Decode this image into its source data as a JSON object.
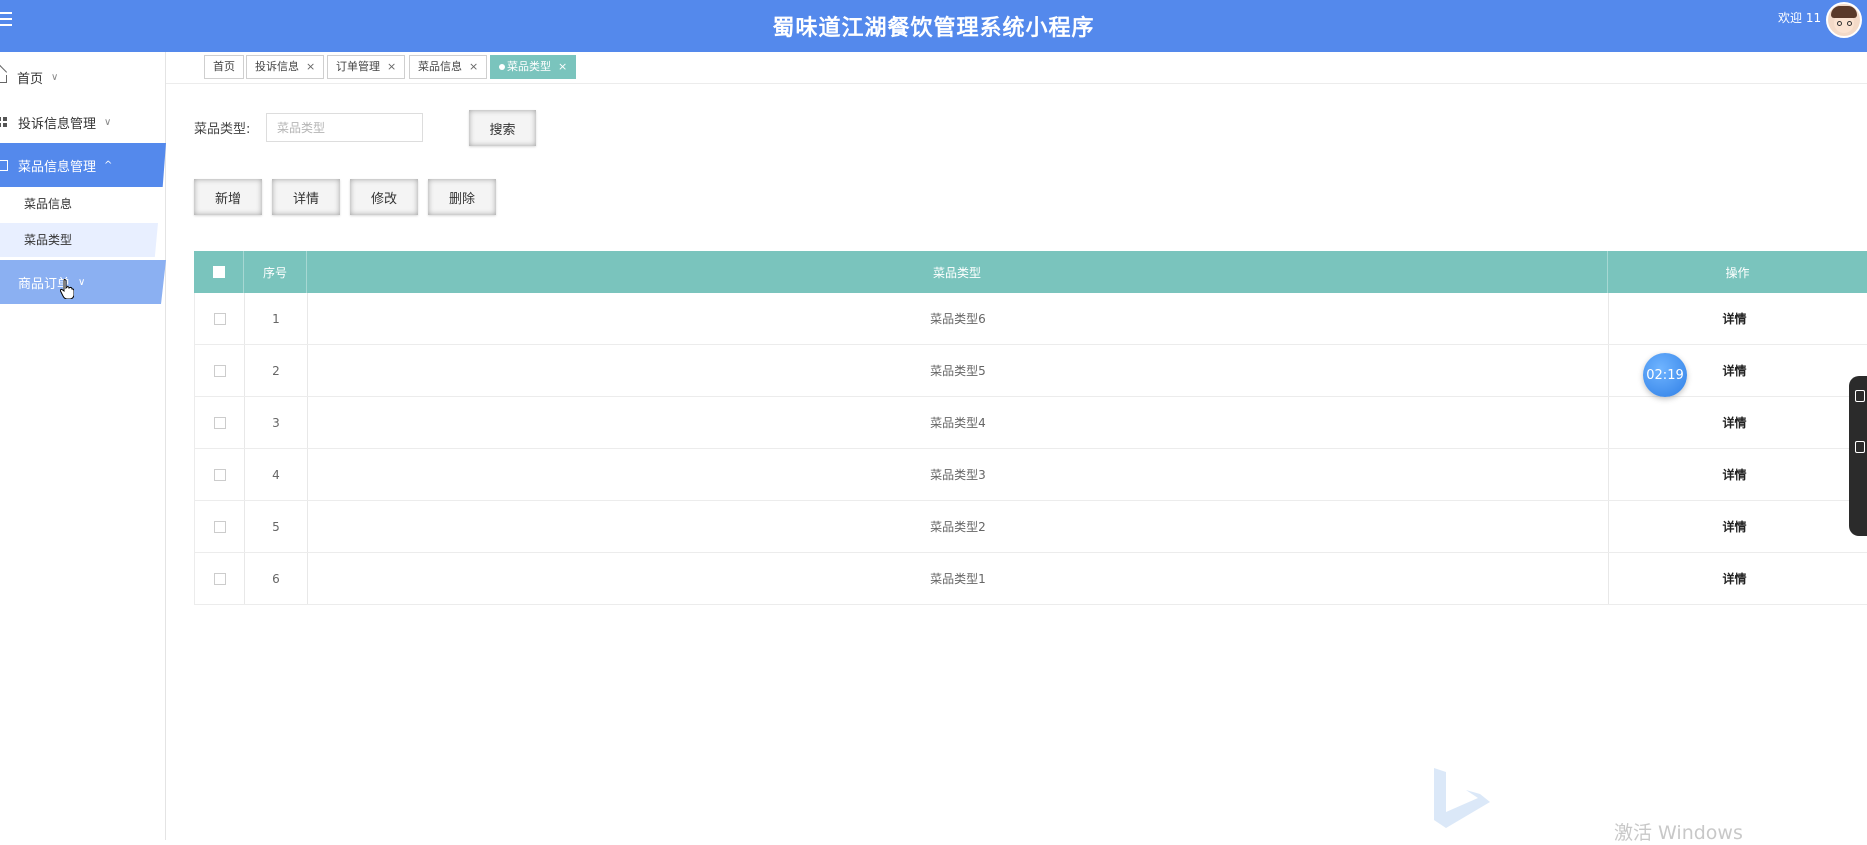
{
  "header": {
    "title": "蜀味道江湖餐饮管理系统小程序",
    "welcome": "欢迎 11"
  },
  "sidebar": {
    "items": [
      {
        "label": "首页",
        "chevron": "∨"
      },
      {
        "label": "投诉信息管理",
        "chevron": "∨"
      },
      {
        "label": "菜品信息管理",
        "chevron": "^"
      },
      {
        "label": "商品订单",
        "chevron": "∨"
      }
    ],
    "sub_items": [
      {
        "label": "菜品信息"
      },
      {
        "label": "菜品类型"
      }
    ]
  },
  "tabs": [
    {
      "label": "首页"
    },
    {
      "label": "投诉信息",
      "close": "×"
    },
    {
      "label": "订单管理",
      "close": "×"
    },
    {
      "label": "菜品信息",
      "close": "×"
    },
    {
      "label": "菜品类型",
      "close": "×",
      "active": true
    }
  ],
  "search": {
    "label": "菜品类型:",
    "placeholder": "菜品类型",
    "value": "",
    "button": "搜索"
  },
  "actions": {
    "add": "新增",
    "detail": "详情",
    "edit": "修改",
    "delete": "删除"
  },
  "table": {
    "columns": [
      "",
      "序号",
      "菜品类型",
      "操作"
    ],
    "rows": [
      {
        "index": "1",
        "type": "菜品类型6",
        "op": "详情"
      },
      {
        "index": "2",
        "type": "菜品类型5",
        "op": "详情"
      },
      {
        "index": "3",
        "type": "菜品类型4",
        "op": "详情"
      },
      {
        "index": "4",
        "type": "菜品类型3",
        "op": "详情"
      },
      {
        "index": "5",
        "type": "菜品类型2",
        "op": "详情"
      },
      {
        "index": "6",
        "type": "菜品类型1",
        "op": "详情"
      }
    ]
  },
  "overlay": {
    "timer": "02:19",
    "watermark": "激活 Windows"
  },
  "colors": {
    "header": "#5489ec",
    "table_header": "#7ac4bd",
    "active_tab": "#7ac4bd"
  }
}
